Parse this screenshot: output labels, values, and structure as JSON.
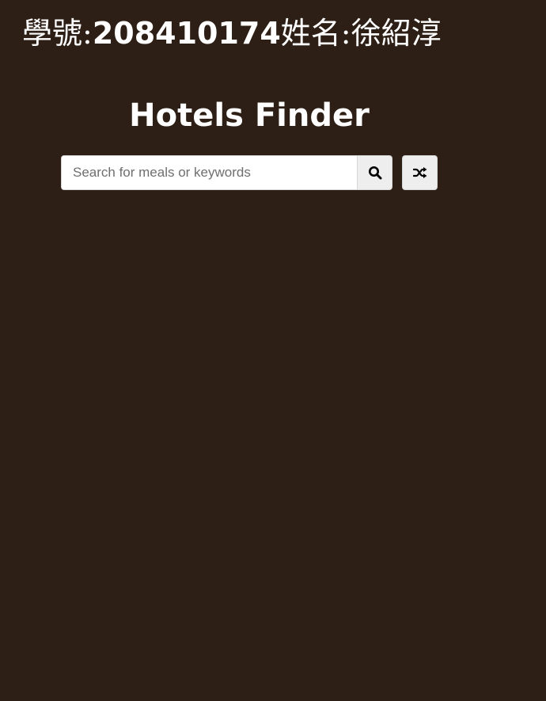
{
  "header": {
    "id_label": "學號:",
    "id_number": "208410174",
    "name_label": "姓名:",
    "name_value": "徐紹淳"
  },
  "title": "Hotels Finder",
  "search": {
    "placeholder": "Search for meals or keywords",
    "value": ""
  },
  "icons": {
    "search_button": "search-icon",
    "random_button": "shuffle-icon"
  },
  "colors": {
    "background": "#2d1f15",
    "text": "#ffffff",
    "button_background": "#eeeeee"
  }
}
